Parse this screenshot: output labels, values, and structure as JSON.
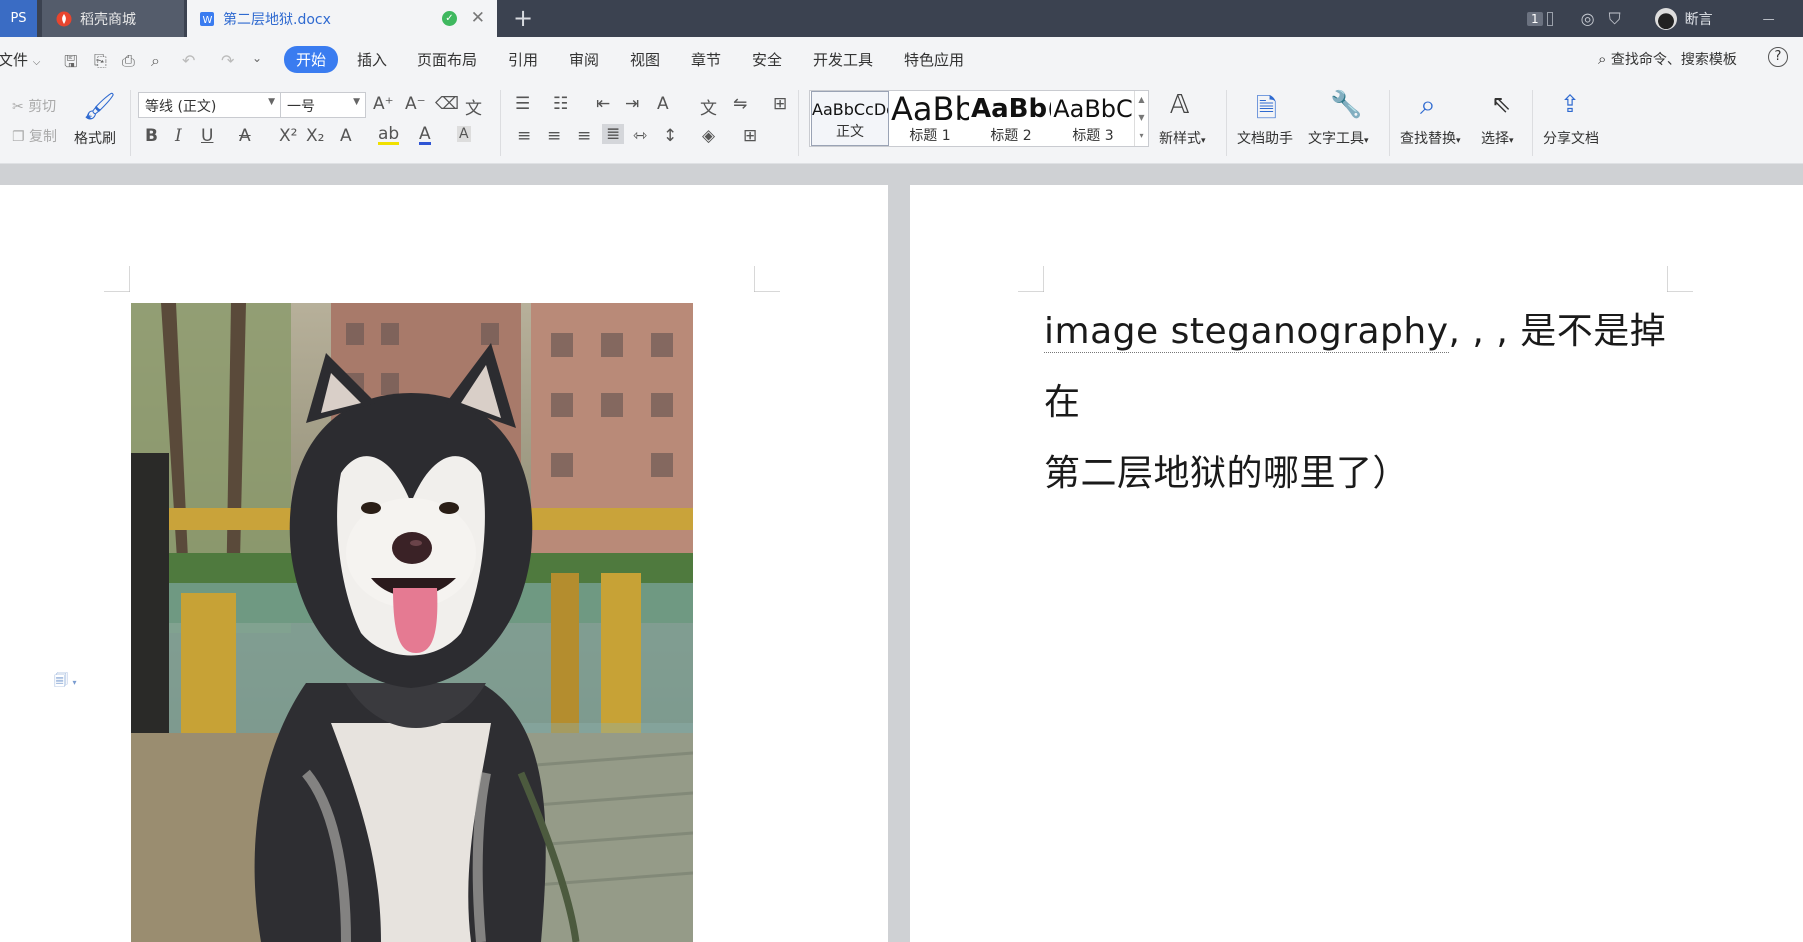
{
  "tabs": {
    "wps": "PS",
    "store": "稻壳商城",
    "doc": "第二层地狱.docx",
    "new_tab": "+"
  },
  "titlebar_right": {
    "badge": "1",
    "user": "断言",
    "minimize": "—"
  },
  "menu": {
    "file": "文件",
    "items": [
      "开始",
      "插入",
      "页面布局",
      "引用",
      "审阅",
      "视图",
      "章节",
      "安全",
      "开发工具",
      "特色应用"
    ],
    "search": "查找命令、搜索模板"
  },
  "ribbon": {
    "cut": "剪切",
    "copy": "复制",
    "format_painter": "格式刷",
    "font_name": "等线 (正文)",
    "font_size": "一号",
    "styles": [
      {
        "sample": "AaBbCcDd",
        "label": "正文"
      },
      {
        "sample": "AaBb",
        "label": "标题 1"
      },
      {
        "sample": "AaBb(",
        "label": "标题 2"
      },
      {
        "sample": "AaBbC",
        "label": "标题 3"
      }
    ],
    "new_style": "新样式",
    "doc_assistant": "文档助手",
    "text_tools": "文字工具",
    "find_replace": "查找替换",
    "select": "选择",
    "share_doc": "分享文档"
  },
  "document": {
    "text_line1_word": "image steganography",
    "text_line1_rest": ", , , 是不是掉在",
    "text_line2": "第二层地狱的哪里了）"
  }
}
